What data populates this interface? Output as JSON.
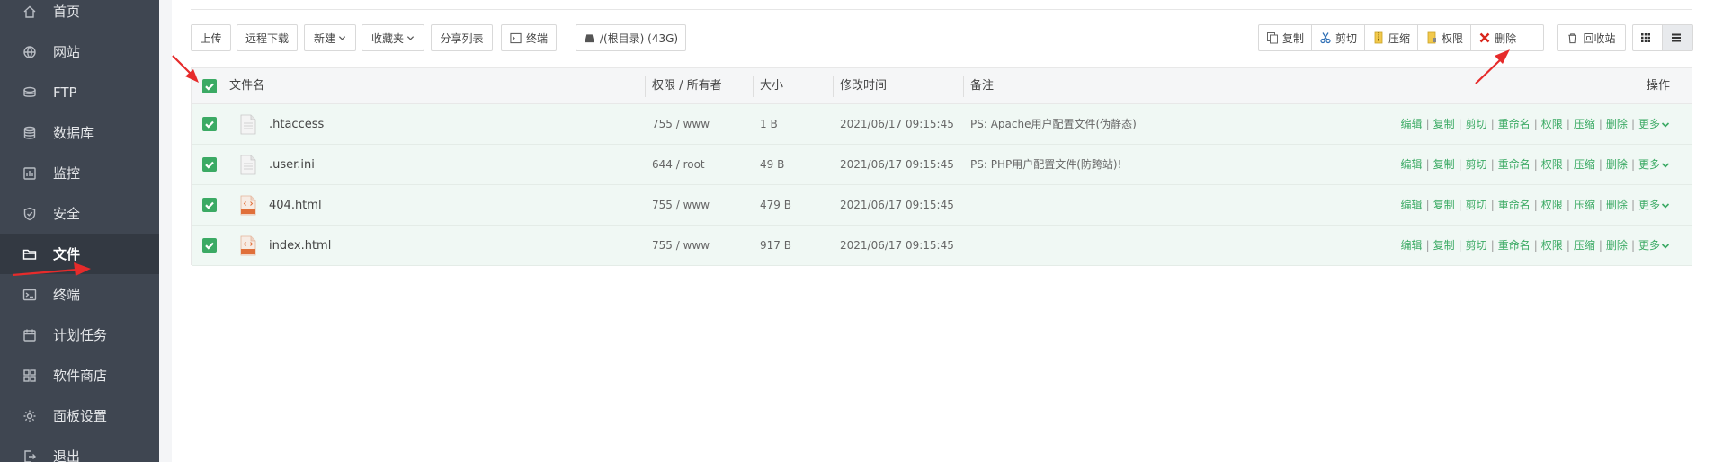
{
  "sidebar": {
    "items": [
      {
        "label": "首页",
        "icon": "home-icon"
      },
      {
        "label": "网站",
        "icon": "globe-icon"
      },
      {
        "label": "FTP",
        "icon": "ftp-icon"
      },
      {
        "label": "数据库",
        "icon": "database-icon"
      },
      {
        "label": "监控",
        "icon": "monitor-icon"
      },
      {
        "label": "安全",
        "icon": "shield-icon"
      },
      {
        "label": "文件",
        "icon": "folder-icon",
        "active": true
      },
      {
        "label": "终端",
        "icon": "terminal-icon"
      },
      {
        "label": "计划任务",
        "icon": "calendar-icon"
      },
      {
        "label": "软件商店",
        "icon": "apps-icon"
      },
      {
        "label": "面板设置",
        "icon": "gear-icon"
      },
      {
        "label": "退出",
        "icon": "logout-icon"
      }
    ]
  },
  "toolbar": {
    "upload": "上传",
    "remote_download": "远程下载",
    "new": "新建",
    "favorites": "收藏夹",
    "share_list": "分享列表",
    "terminal": "终端",
    "path": "/(根目录) (43G)",
    "copy": "复制",
    "cut": "剪切",
    "compress": "压缩",
    "permission": "权限",
    "delete": "删除",
    "recycle_bin": "回收站"
  },
  "table": {
    "headers": {
      "name": "文件名",
      "permission": "权限 / 所有者",
      "size": "大小",
      "mtime": "修改时间",
      "note": "备注",
      "ops": "操作"
    },
    "rows": [
      {
        "name": ".htaccess",
        "type": "text",
        "permission": "755 / www",
        "size": "1 B",
        "mtime": "2021/06/17 09:15:45",
        "note": "PS: Apache用户配置文件(伪静态)"
      },
      {
        "name": ".user.ini",
        "type": "text",
        "permission": "644 / root",
        "size": "49 B",
        "mtime": "2021/06/17 09:15:45",
        "note": "PS: PHP用户配置文件(防跨站)!"
      },
      {
        "name": "404.html",
        "type": "html",
        "permission": "755 / www",
        "size": "479 B",
        "mtime": "2021/06/17 09:15:45",
        "note": ""
      },
      {
        "name": "index.html",
        "type": "html",
        "permission": "755 / www",
        "size": "917 B",
        "mtime": "2021/06/17 09:15:45",
        "note": ""
      }
    ],
    "row_ops": [
      "编辑",
      "复制",
      "剪切",
      "重命名",
      "权限",
      "压缩",
      "删除",
      "更多"
    ]
  },
  "colors": {
    "sidebar_bg": "#3f4651",
    "accent_green": "#3baa64",
    "arrow_red": "#e62b2b"
  }
}
